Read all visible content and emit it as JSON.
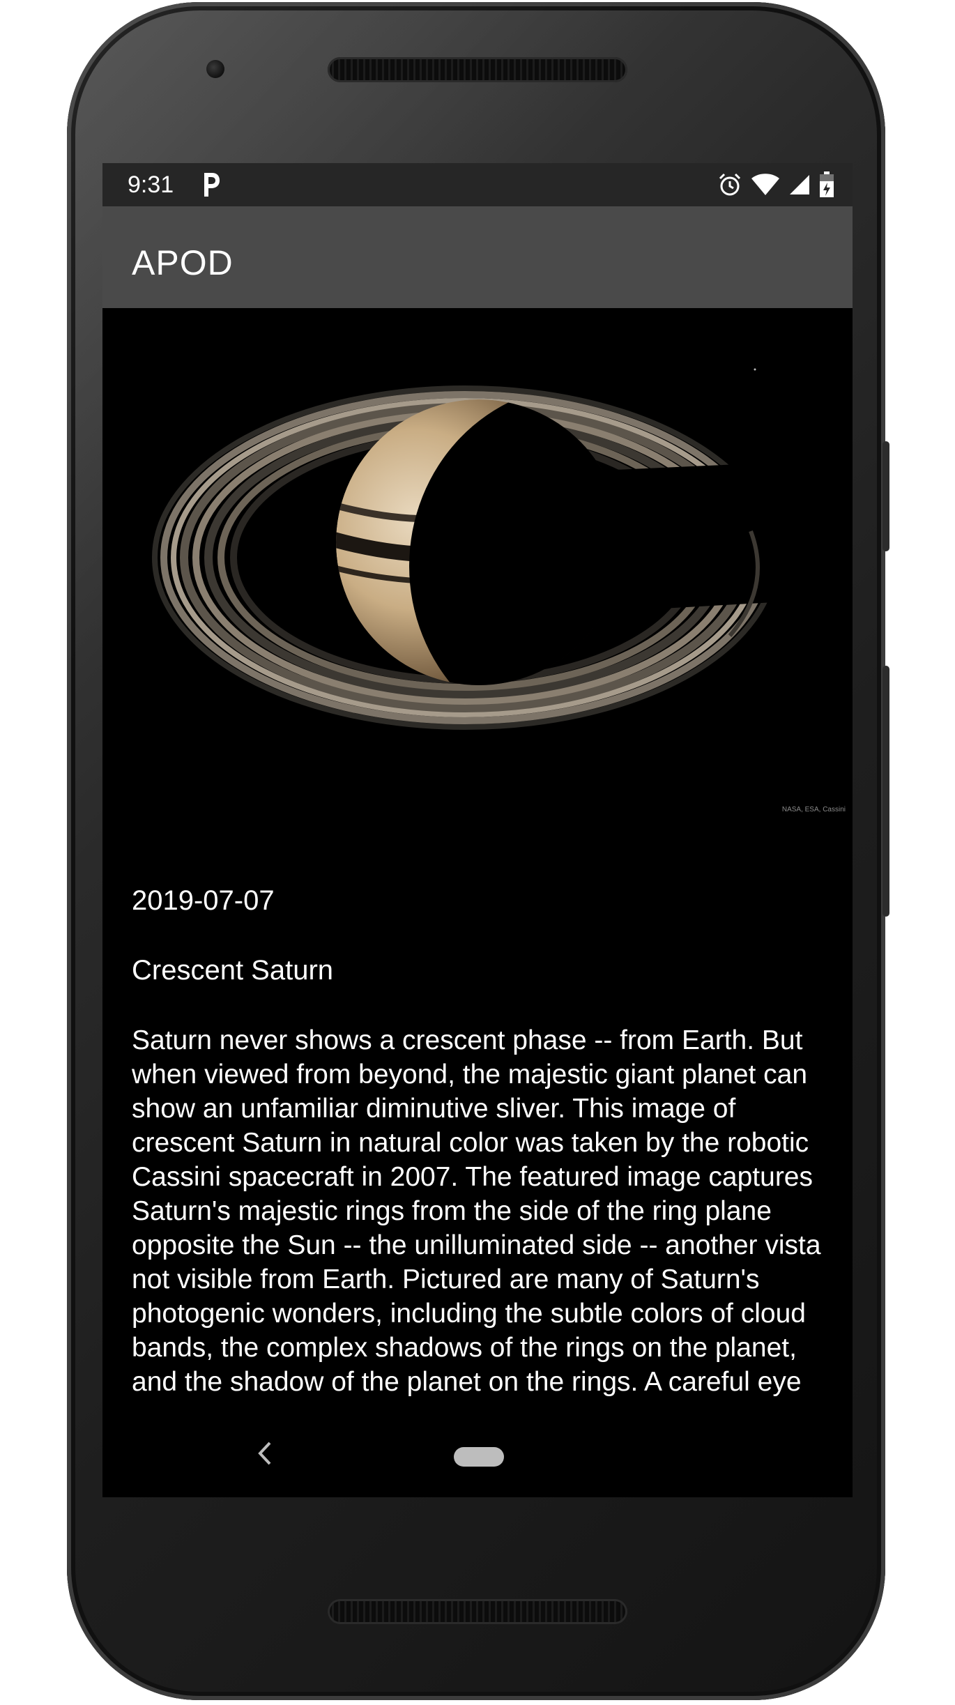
{
  "status_bar": {
    "time": "9:31",
    "icons": [
      "parking-app-icon",
      "alarm-icon",
      "wifi-icon",
      "signal-icon",
      "battery-icon"
    ]
  },
  "app_bar": {
    "title": "APOD"
  },
  "apod": {
    "image_alt": "Crescent Saturn with rings",
    "image_credit": "NASA, ESA, Cassini",
    "date": "2019-07-07",
    "title": "Crescent Saturn",
    "explanation": "Saturn never shows a crescent phase -- from Earth. But when viewed from beyond, the majestic giant planet can show an unfamiliar diminutive sliver. This image of crescent Saturn in natural color was taken by the robotic Cassini spacecraft in 2007. The featured image captures Saturn's majestic rings from the side of the ring plane opposite the Sun -- the unilluminated side -- another vista not visible from Earth. Pictured are many of Saturn's photogenic wonders, including the subtle colors of cloud bands, the complex shadows of the rings on the planet, and the shadow of the planet on the rings. A careful eye"
  },
  "nav_bar": {
    "icons": [
      "back-icon",
      "home-icon"
    ]
  },
  "colors": {
    "status_bar": "#262626",
    "app_bar": "#4a4a4a",
    "background": "#000000",
    "text": "#ffffff"
  }
}
